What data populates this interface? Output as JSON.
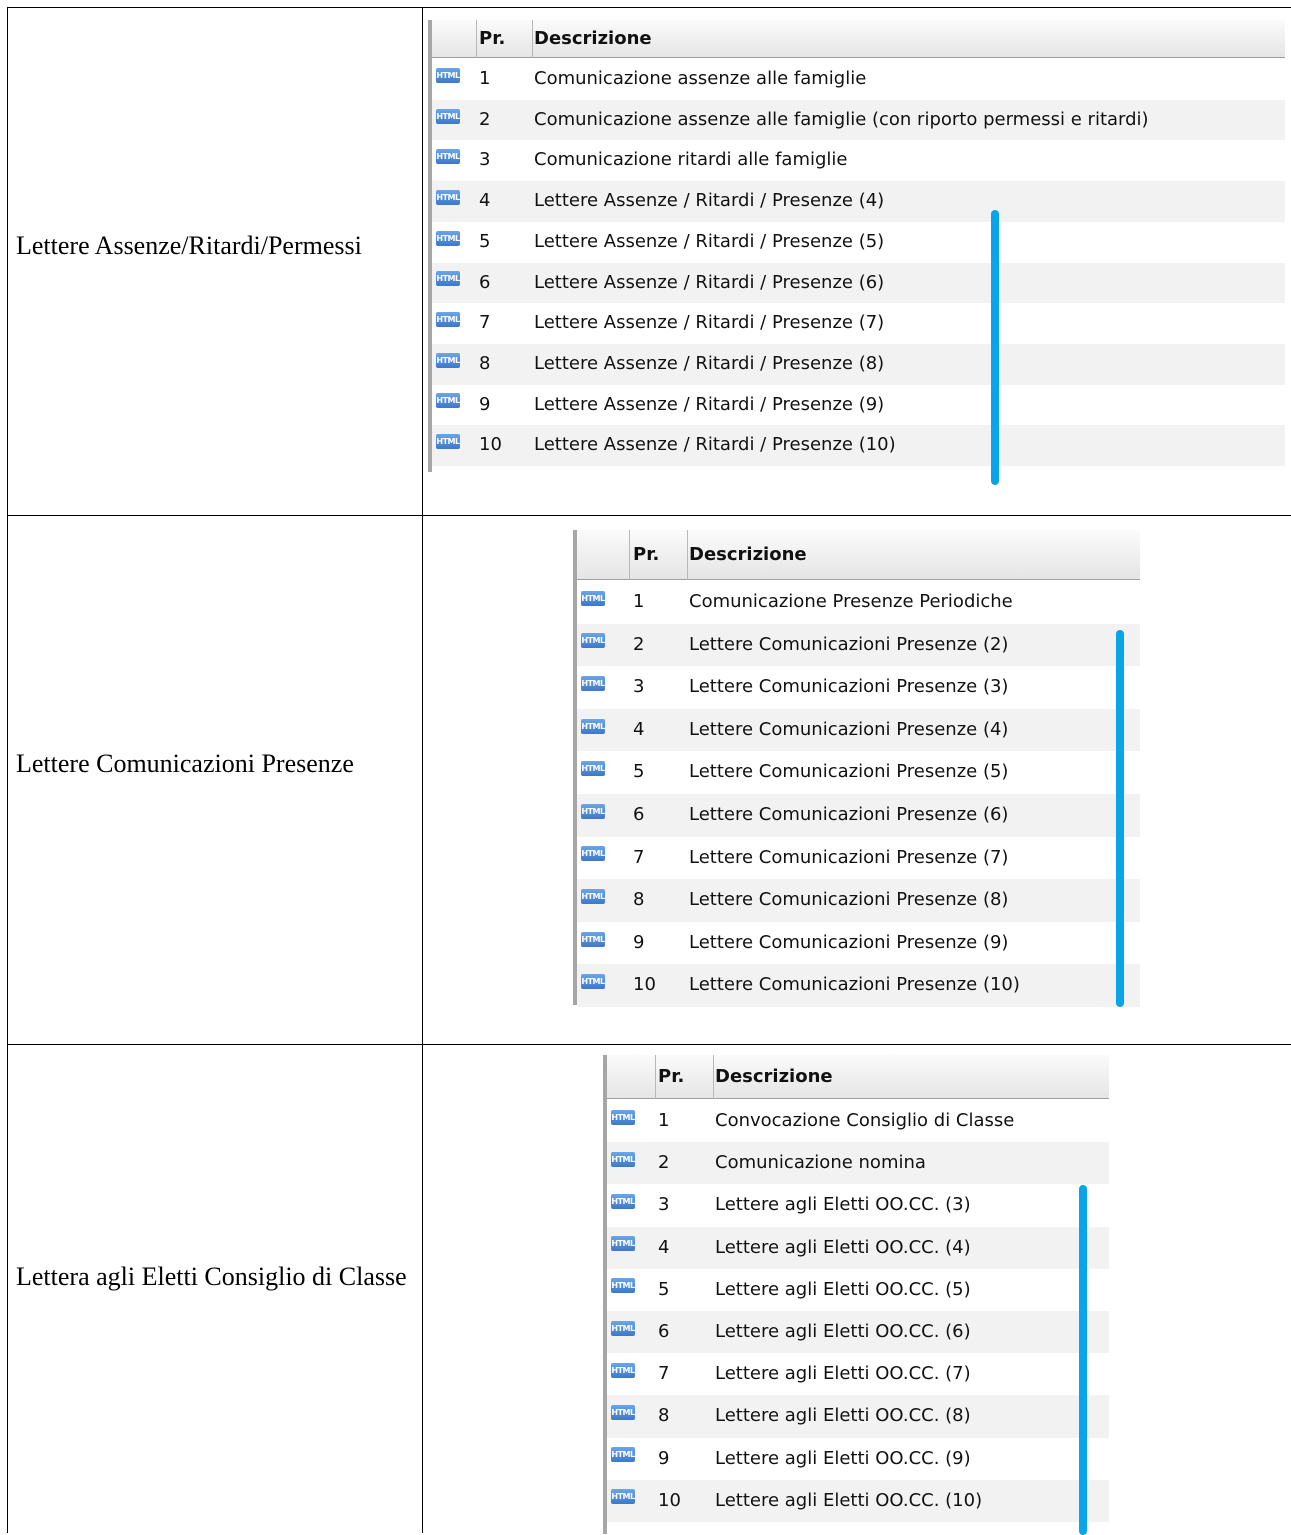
{
  "columns": {
    "pr": "Pr.",
    "desc": "Descrizione"
  },
  "icon_label": "HTML",
  "sections": [
    {
      "label": "Lettere Assenze/Ritardi/Permessi",
      "rows": [
        {
          "num": "1",
          "desc": "Comunicazione assenze alle famiglie"
        },
        {
          "num": "2",
          "desc": "Comunicazione assenze alle famiglie (con riporto permessi e ritardi)"
        },
        {
          "num": "3",
          "desc": "Comunicazione ritardi alle famiglie"
        },
        {
          "num": "4",
          "desc": "Lettere Assenze / Ritardi / Presenze (4)"
        },
        {
          "num": "5",
          "desc": "Lettere Assenze / Ritardi / Presenze (5)"
        },
        {
          "num": "6",
          "desc": "Lettere Assenze / Ritardi / Presenze (6)"
        },
        {
          "num": "7",
          "desc": "Lettere Assenze / Ritardi / Presenze (7)"
        },
        {
          "num": "8",
          "desc": "Lettere Assenze / Ritardi / Presenze (8)"
        },
        {
          "num": "9",
          "desc": "Lettere Assenze / Ritardi / Presenze (9)"
        },
        {
          "num": "10",
          "desc": "Lettere Assenze / Ritardi / Presenze (10)"
        }
      ]
    },
    {
      "label": "Lettere Comunicazioni Presenze",
      "rows": [
        {
          "num": "1",
          "desc": "Comunicazione Presenze Periodiche"
        },
        {
          "num": "2",
          "desc": "Lettere Comunicazioni Presenze (2)"
        },
        {
          "num": "3",
          "desc": "Lettere Comunicazioni Presenze (3)"
        },
        {
          "num": "4",
          "desc": "Lettere Comunicazioni Presenze (4)"
        },
        {
          "num": "5",
          "desc": "Lettere Comunicazioni Presenze (5)"
        },
        {
          "num": "6",
          "desc": "Lettere Comunicazioni Presenze (6)"
        },
        {
          "num": "7",
          "desc": "Lettere Comunicazioni Presenze (7)"
        },
        {
          "num": "8",
          "desc": "Lettere Comunicazioni Presenze (8)"
        },
        {
          "num": "9",
          "desc": "Lettere Comunicazioni Presenze (9)"
        },
        {
          "num": "10",
          "desc": "Lettere Comunicazioni Presenze (10)"
        }
      ]
    },
    {
      "label": "Lettera agli Eletti Consiglio di Classe",
      "rows": [
        {
          "num": "1",
          "desc": "Convocazione Consiglio di Classe"
        },
        {
          "num": "2",
          "desc": "Comunicazione nomina"
        },
        {
          "num": "3",
          "desc": "Lettere agli Eletti OO.CC. (3)"
        },
        {
          "num": "4",
          "desc": "Lettere agli Eletti OO.CC. (4)"
        },
        {
          "num": "5",
          "desc": "Lettere agli Eletti OO.CC. (5)"
        },
        {
          "num": "6",
          "desc": "Lettere agli Eletti OO.CC. (6)"
        },
        {
          "num": "7",
          "desc": "Lettere agli Eletti OO.CC. (7)"
        },
        {
          "num": "8",
          "desc": "Lettere agli Eletti OO.CC. (8)"
        },
        {
          "num": "9",
          "desc": "Lettere agli Eletti OO.CC. (9)"
        },
        {
          "num": "10",
          "desc": "Lettere agli Eletti OO.CC. (10)"
        }
      ]
    }
  ],
  "colors": {
    "accent_bar": "#0aa4ea",
    "icon": "#3c78c8",
    "row_alt": "#f2f2f2"
  }
}
